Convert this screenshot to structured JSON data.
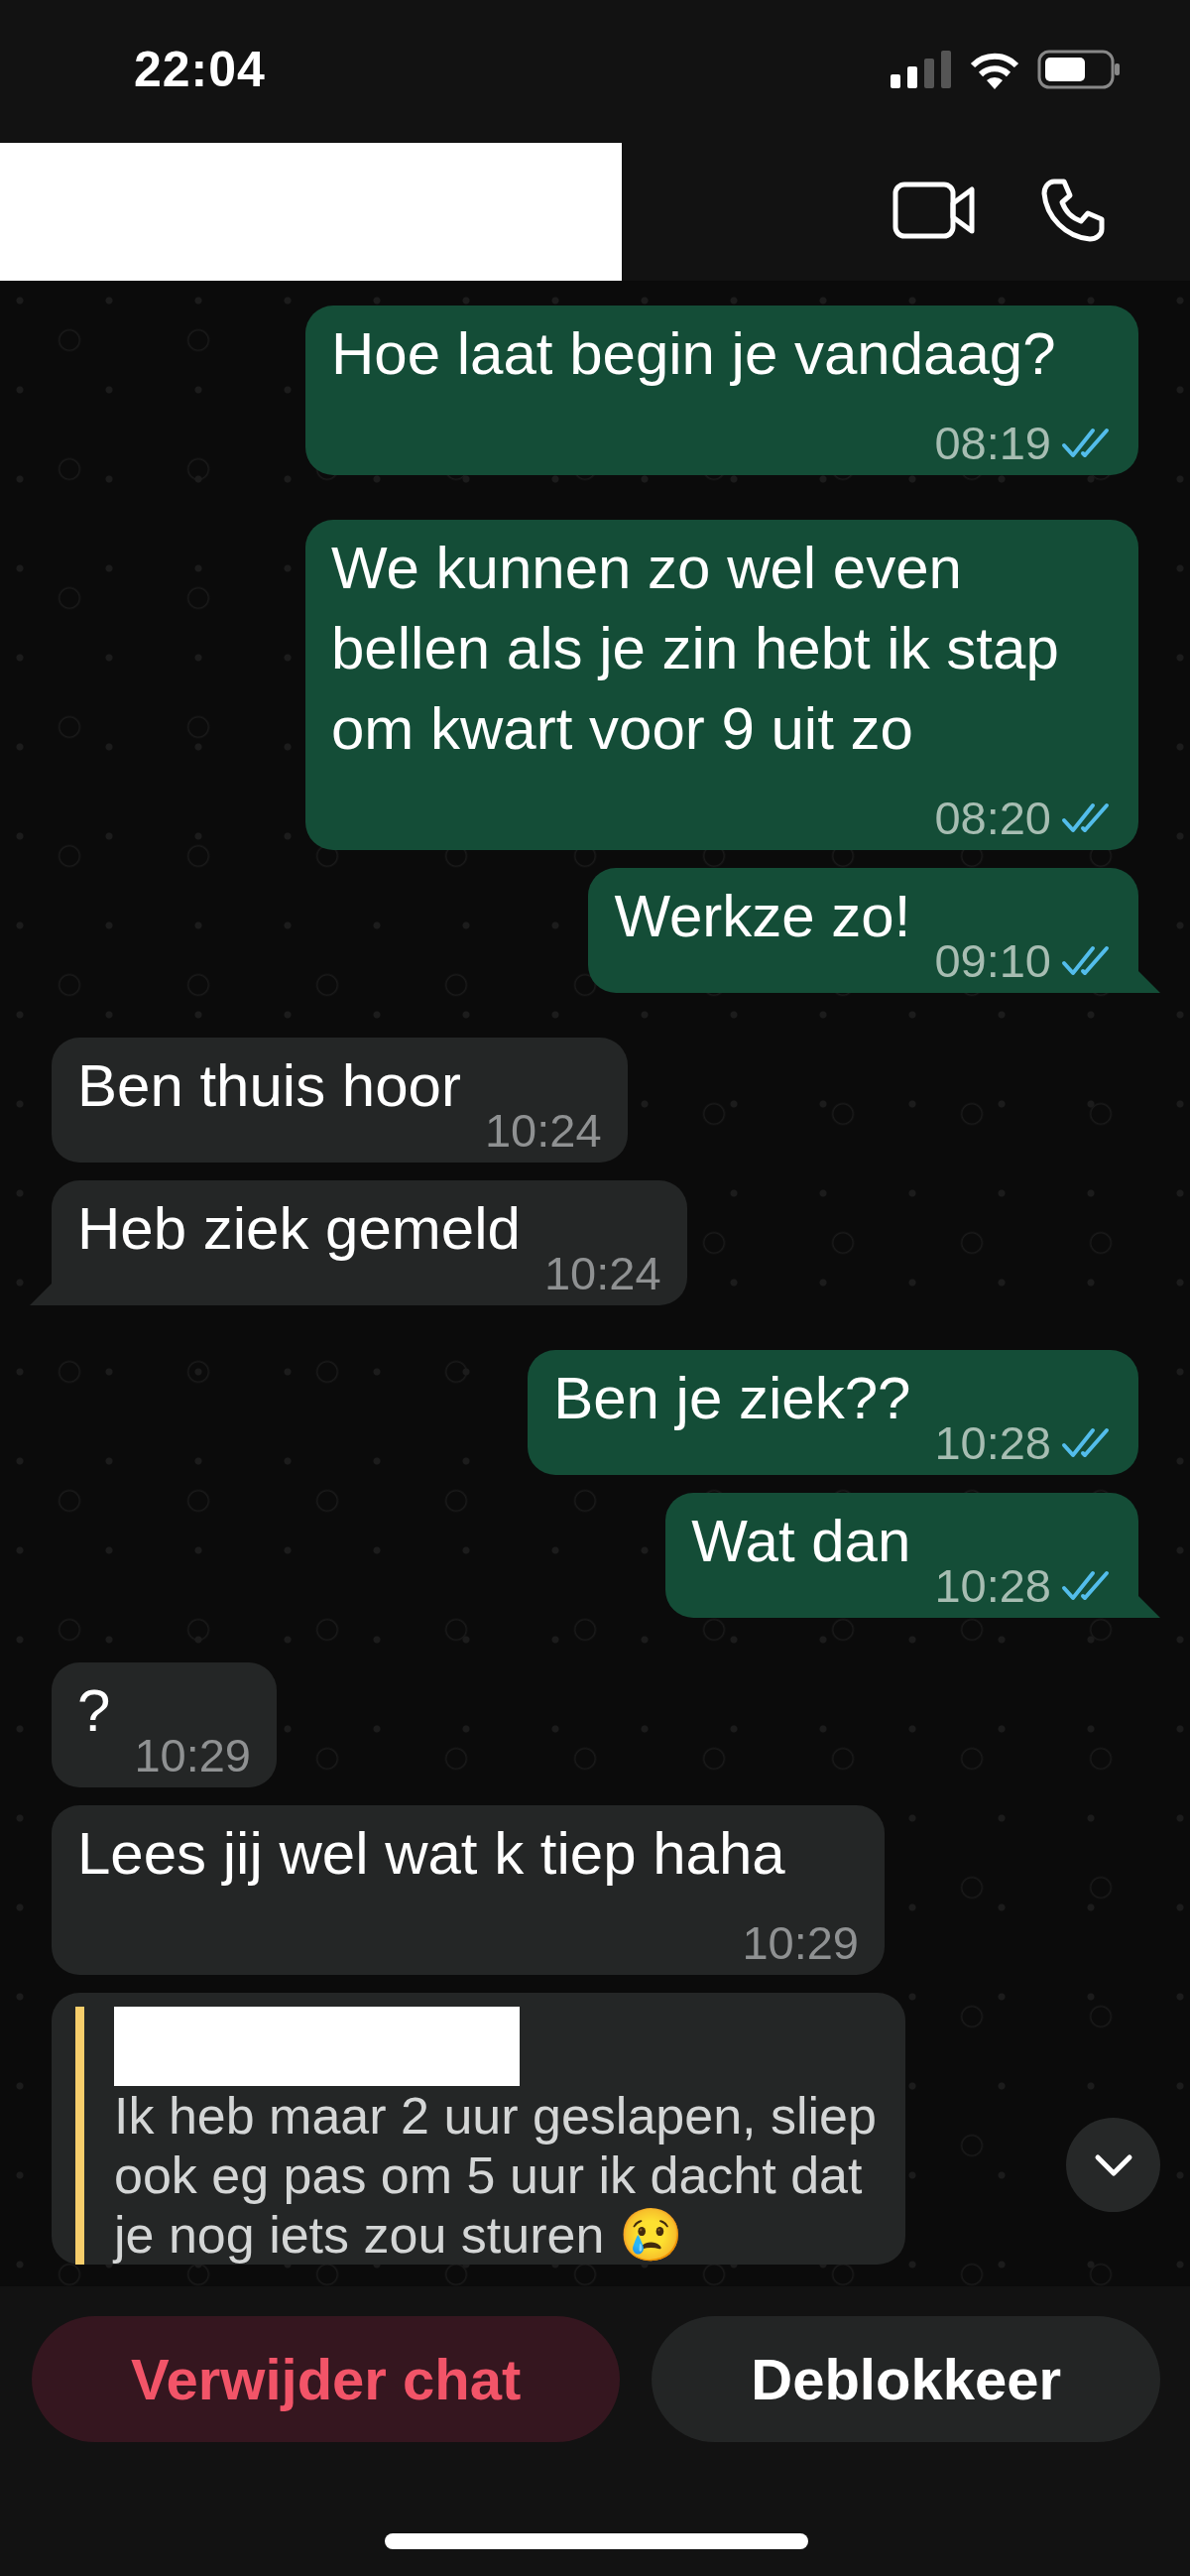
{
  "status_bar": {
    "time": "22:04"
  },
  "messages": [
    {
      "kind": "sent",
      "text": "Hoe laat begin je vandaag?",
      "time": "08:19",
      "read": true,
      "tail": false
    },
    {
      "kind": "sent",
      "text": "We kunnen zo wel even bellen als je zin hebt ik stap om kwart voor 9 uit zo",
      "time": "08:20",
      "read": true,
      "tail": false
    },
    {
      "kind": "sent",
      "text": "Werkze zo!",
      "time": "09:10",
      "read": true,
      "tail": true
    },
    {
      "kind": "received",
      "text": "Ben thuis hoor",
      "time": "10:24",
      "tail": false
    },
    {
      "kind": "received",
      "text": "Heb ziek gemeld",
      "time": "10:24",
      "tail": true
    },
    {
      "kind": "sent",
      "text": "Ben je ziek??",
      "time": "10:28",
      "read": true,
      "tail": false
    },
    {
      "kind": "sent",
      "text": "Wat dan",
      "time": "10:28",
      "read": true,
      "tail": true
    },
    {
      "kind": "received",
      "text": "?",
      "time": "10:29",
      "tail": false
    },
    {
      "kind": "received",
      "text": "Lees jij wel wat k tiep haha",
      "time": "10:29",
      "tail": false
    },
    {
      "kind": "received",
      "quote": {
        "text": "Ik heb maar 2 uur geslapen, sliep ook eg pas om 5 uur ik dacht dat je nog iets zou sturen 😢"
      },
      "tail": false
    }
  ],
  "actions": [
    {
      "label": "Verwijder chat",
      "kind": "danger"
    },
    {
      "label": "Deblokkeer",
      "kind": "normal"
    }
  ]
}
